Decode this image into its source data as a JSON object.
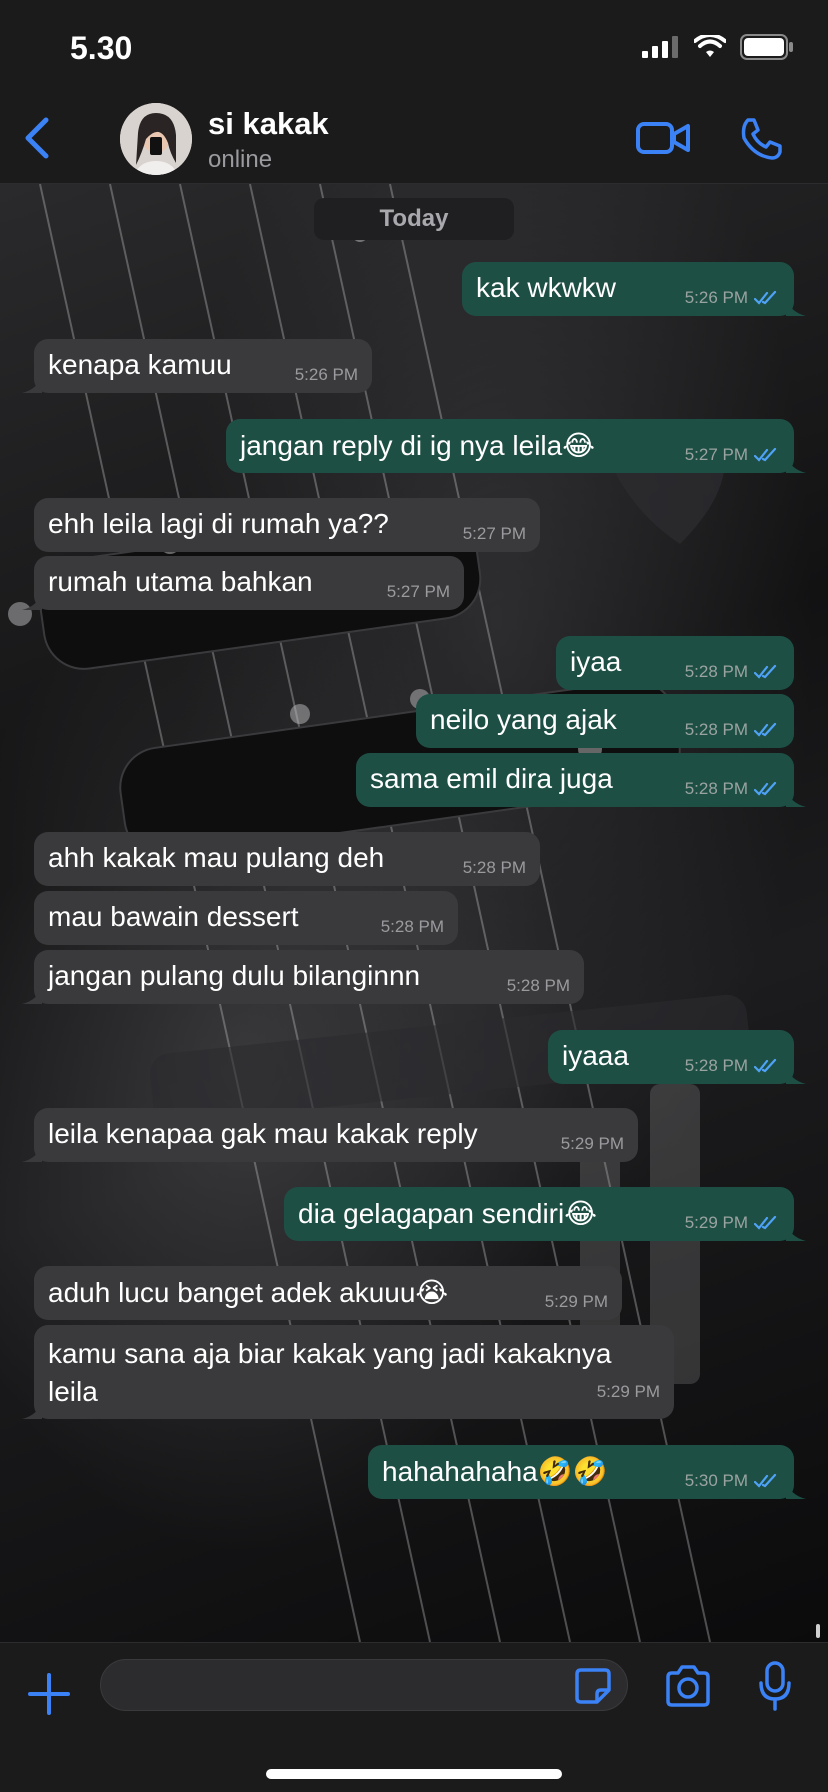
{
  "status_bar": {
    "time": "5.30"
  },
  "header": {
    "contact_name": "si kakak",
    "contact_status": "online"
  },
  "chat": {
    "date_label": "Today",
    "messages": [
      {
        "dir": "out",
        "text": "kak wkwkw",
        "time": "5:26 PM",
        "read": true
      },
      {
        "dir": "in",
        "text": "kenapa kamuu",
        "time": "5:26 PM"
      },
      {
        "dir": "out",
        "text": "jangan reply di ig nya leila😂",
        "time": "5:27 PM",
        "read": true
      },
      {
        "dir": "in",
        "text": "ehh leila lagi di rumah ya??",
        "time": "5:27 PM"
      },
      {
        "dir": "in",
        "text": "rumah utama bahkan",
        "time": "5:27 PM"
      },
      {
        "dir": "out",
        "text": "iyaa",
        "time": "5:28 PM",
        "read": true
      },
      {
        "dir": "out",
        "text": "neilo yang ajak",
        "time": "5:28 PM",
        "read": true
      },
      {
        "dir": "out",
        "text": "sama emil dira juga",
        "time": "5:28 PM",
        "read": true
      },
      {
        "dir": "in",
        "text": "ahh kakak mau pulang deh",
        "time": "5:28 PM"
      },
      {
        "dir": "in",
        "text": "mau bawain dessert",
        "time": "5:28 PM"
      },
      {
        "dir": "in",
        "text": "jangan pulang dulu bilanginnn",
        "time": "5:28 PM"
      },
      {
        "dir": "out",
        "text": "iyaaa",
        "time": "5:28 PM",
        "read": true
      },
      {
        "dir": "in",
        "text": "leila kenapaa gak mau kakak reply",
        "time": "5:29 PM"
      },
      {
        "dir": "out",
        "text": "dia gelagapan sendiri😂",
        "time": "5:29 PM",
        "read": true
      },
      {
        "dir": "in",
        "text": "aduh lucu banget adek akuuu😭",
        "time": "5:29 PM"
      },
      {
        "dir": "in",
        "text_line1": "kamu sana aja biar kakak yang jadi kakaknya",
        "text_line2": "leila",
        "time": "5:29 PM"
      },
      {
        "dir": "out",
        "text": "hahahahaha🤣🤣",
        "time": "5:30 PM",
        "read": true
      }
    ]
  },
  "input_bar": {
    "placeholder": ""
  },
  "colors": {
    "accent": "#3b82f6",
    "incoming_bubble": "#3a3a3c",
    "outgoing_bubble": "#1e4f45",
    "read_check": "#4fa3f7"
  }
}
